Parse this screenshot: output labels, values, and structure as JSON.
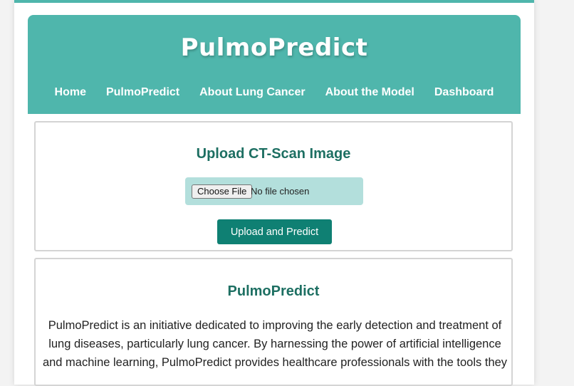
{
  "header": {
    "brand": "PulmoPredict",
    "nav": [
      {
        "label": "Home"
      },
      {
        "label": "PulmoPredict"
      },
      {
        "label": "About Lung Cancer"
      },
      {
        "label": "About the Model"
      },
      {
        "label": "Dashboard"
      }
    ]
  },
  "upload": {
    "title": "Upload CT-Scan Image",
    "choose_file_label": "Choose File",
    "file_status": "No file chosen",
    "submit_label": "Upload and Predict"
  },
  "info": {
    "title": "PulmoPredict",
    "paragraph": "PulmoPredict is an initiative dedicated to improving the early detection and treatment of lung diseases, particularly lung cancer. By harnessing the power of artificial intelligence and machine learning, PulmoPredict provides healthcare professionals with the tools they"
  },
  "colors": {
    "accent": "#4fb6ac",
    "button": "#0f8073",
    "heading": "#1d6f62",
    "file_box": "#b3dfdc"
  }
}
